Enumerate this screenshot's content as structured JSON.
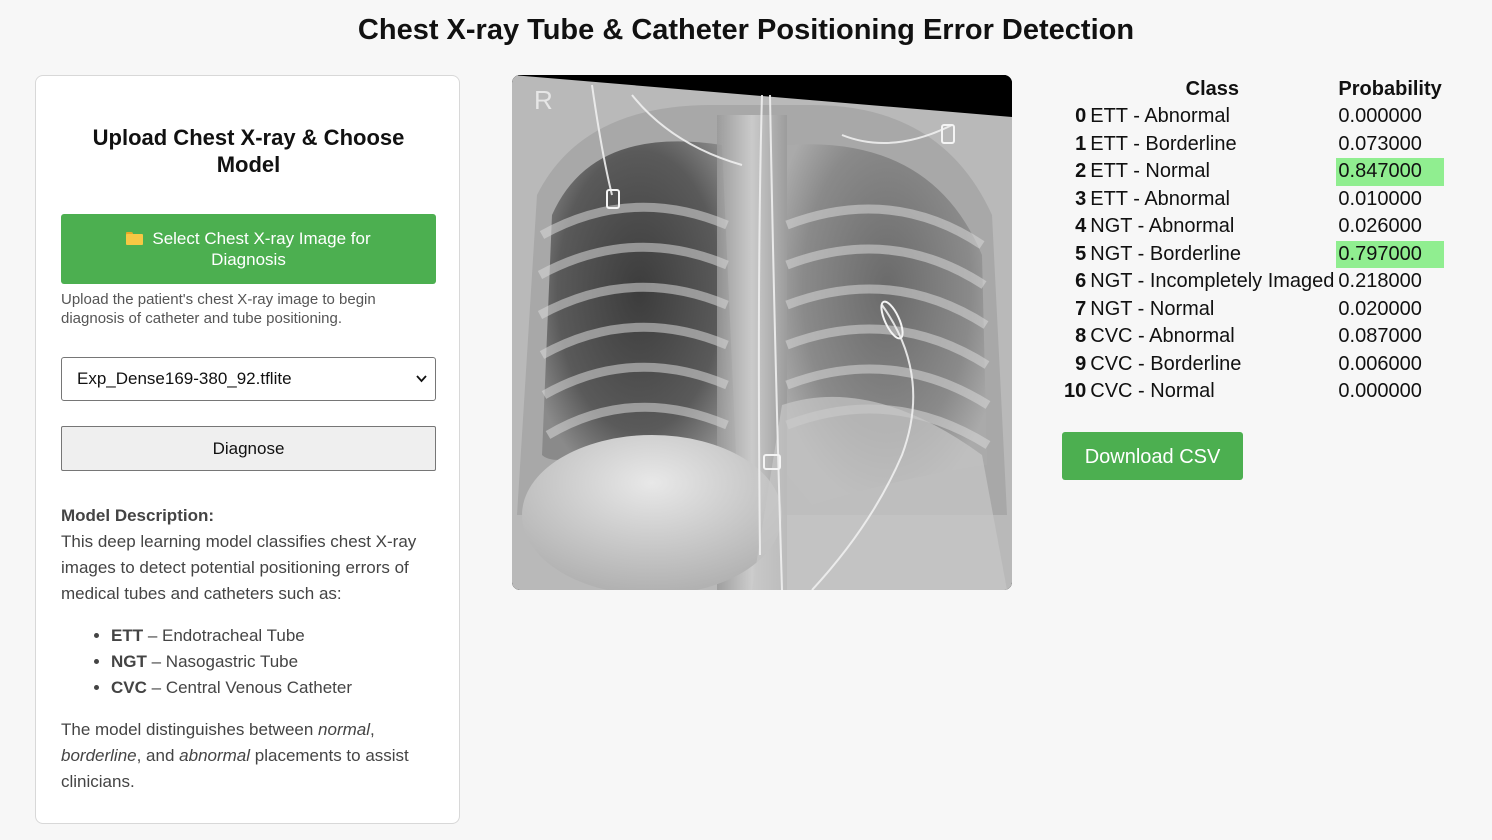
{
  "page": {
    "title": "Chest X-ray Tube & Catheter Positioning Error Detection"
  },
  "upload_panel": {
    "heading": "Upload Chest X-ray & Choose Model",
    "upload_button_label": "Select Chest X-ray Image for Diagnosis",
    "upload_button_icon": "folder-icon",
    "upload_hint": "Upload the patient's chest X-ray image to begin diagnosis of catheter and tube positioning.",
    "model_select": {
      "selected": "Exp_Dense169-380_92.tflite"
    },
    "diagnose_button_label": "Diagnose",
    "description": {
      "heading": "Model Description:",
      "text": "This deep learning model classifies chest X-ray images to detect potential positioning errors of medical tubes and catheters such as:",
      "items": [
        {
          "abbr": "ETT",
          "sep": " – ",
          "name": "Endotracheal Tube"
        },
        {
          "abbr": "NGT",
          "sep": " – ",
          "name": "Nasogastric Tube"
        },
        {
          "abbr": "CVC",
          "sep": " – ",
          "name": "Central Venous Catheter"
        }
      ],
      "footer": {
        "part1": "The model distinguishes between ",
        "normal": "normal",
        "part2": ", ",
        "borderline": "borderline",
        "part3": ", and ",
        "abnormal": "abnormal",
        "part4": " placements to assist clinicians."
      }
    }
  },
  "xray": {
    "marker": "R"
  },
  "results": {
    "headers": {
      "index": "",
      "class": "Class",
      "probability": "Probability"
    },
    "highlight_color": "#90ee90",
    "rows": [
      {
        "index": "0",
        "class": "ETT - Abnormal",
        "probability": "0.000000",
        "highlight": false
      },
      {
        "index": "1",
        "class": "ETT - Borderline",
        "probability": "0.073000",
        "highlight": false
      },
      {
        "index": "2",
        "class": "ETT - Normal",
        "probability": "0.847000",
        "highlight": true
      },
      {
        "index": "3",
        "class": "ETT - Abnormal",
        "probability": "0.010000",
        "highlight": false
      },
      {
        "index": "4",
        "class": "NGT - Abnormal",
        "probability": "0.026000",
        "highlight": false
      },
      {
        "index": "5",
        "class": "NGT - Borderline",
        "probability": "0.797000",
        "highlight": true
      },
      {
        "index": "6",
        "class": "NGT - Incompletely Imaged",
        "probability": "0.218000",
        "highlight": false
      },
      {
        "index": "7",
        "class": "NGT - Normal",
        "probability": "0.020000",
        "highlight": false
      },
      {
        "index": "8",
        "class": "CVC - Abnormal",
        "probability": "0.087000",
        "highlight": false
      },
      {
        "index": "9",
        "class": "CVC - Borderline",
        "probability": "0.006000",
        "highlight": false
      },
      {
        "index": "10",
        "class": "CVC - Normal",
        "probability": "0.000000",
        "highlight": false
      }
    ],
    "download_button_label": "Download CSV"
  },
  "colors": {
    "primary_green": "#4caf50",
    "highlight_green": "#90ee90"
  }
}
